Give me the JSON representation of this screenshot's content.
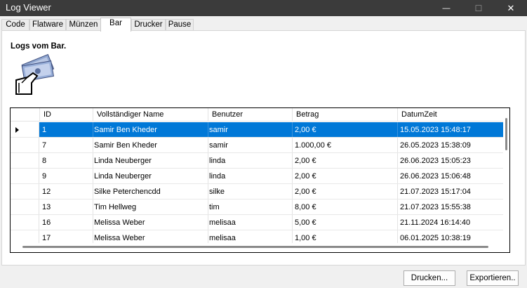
{
  "window": {
    "title": "Log Viewer",
    "min_glyph": "—",
    "max_glyph": "☐",
    "close_glyph": "✕"
  },
  "tabs": [
    {
      "label": "Code"
    },
    {
      "label": "Flatware"
    },
    {
      "label": "Münzen"
    },
    {
      "label": "Bar"
    },
    {
      "label": "Drucker"
    },
    {
      "label": "Pause"
    }
  ],
  "active_tab": "Bar",
  "section": {
    "heading": "Logs vom Bar.",
    "icon": "hand-money-icon"
  },
  "table": {
    "columns": [
      "ID",
      "Vollständiger Name",
      "Benutzer",
      "Betrag",
      "DatumZeit"
    ],
    "rows": [
      {
        "id": "1",
        "name": "Samir Ben Kheder",
        "user": "samir",
        "amount": "2,00 €",
        "datetime": "15.05.2023 15:48:17"
      },
      {
        "id": "7",
        "name": "Samir Ben Kheder",
        "user": "samir",
        "amount": "1.000,00 €",
        "datetime": "26.05.2023 15:38:09"
      },
      {
        "id": "8",
        "name": "Linda Neuberger",
        "user": "linda",
        "amount": "2,00 €",
        "datetime": "26.06.2023 15:05:23"
      },
      {
        "id": "9",
        "name": "Linda Neuberger",
        "user": "linda",
        "amount": "2,00 €",
        "datetime": "26.06.2023 15:06:48"
      },
      {
        "id": "12",
        "name": "Silke Peterchencdd",
        "user": "silke",
        "amount": "2,00 €",
        "datetime": "21.07.2023 15:17:04"
      },
      {
        "id": "13",
        "name": "Tim Hellweg",
        "user": "tim",
        "amount": "8,00 €",
        "datetime": "21.07.2023 15:55:38"
      },
      {
        "id": "16",
        "name": "Melissa Weber",
        "user": "melisaa",
        "amount": "5,00 €",
        "datetime": "21.11.2024 16:14:40"
      },
      {
        "id": "17",
        "name": "Melissa Weber",
        "user": "melisaa",
        "amount": "1,00 €",
        "datetime": "06.01.2025 10:38:19"
      }
    ],
    "selected_row_index": 0
  },
  "buttons": {
    "print": "Drucken...",
    "export": "Exportieren.."
  },
  "colors": {
    "selection": "#0078d7",
    "titlebar": "#3b3b3b"
  }
}
